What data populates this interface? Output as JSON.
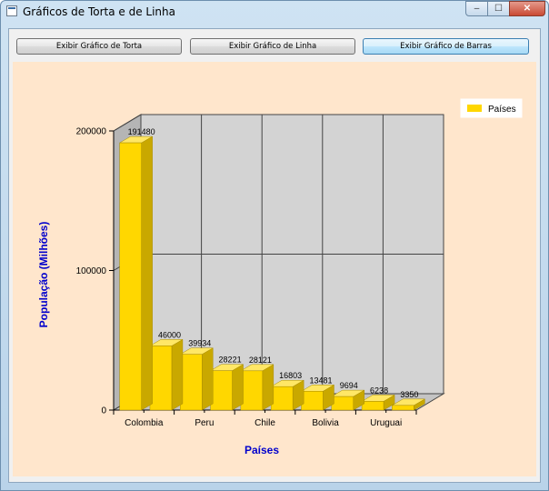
{
  "window": {
    "title": "Gráficos de Torta e de Linha",
    "buttons": {
      "minimize": "–",
      "maximize": "☐",
      "close": "✕"
    }
  },
  "toolbar": {
    "buttons": [
      {
        "label": "Exibir Gráfico de Torta",
        "active": false
      },
      {
        "label": "Exibir Gráfico de Linha",
        "active": false
      },
      {
        "label": "Exibir Gráfico de Barras",
        "active": true
      }
    ]
  },
  "colors": {
    "bar": "#ffd700",
    "bar_side": "#c9a800",
    "bar_top": "#ffe766",
    "plot_back": "#d3d3d3",
    "background": "#ffe6cc",
    "axis_title": "#0000cc"
  },
  "chart_data": {
    "type": "bar",
    "style": "3d",
    "values": [
      191480,
      46000,
      39934,
      28221,
      28121,
      16803,
      13481,
      9694,
      6238,
      3350
    ],
    "data_labels": [
      "191480",
      "46000",
      "39934",
      "28221",
      "28121",
      "16803",
      "13481",
      "9694",
      "6238",
      "3350"
    ],
    "x_tick_labels": [
      "Colombia",
      "Peru",
      "Chile",
      "Bolivia",
      "Uruguai"
    ],
    "y_ticks": [
      0,
      100000,
      200000
    ],
    "y_tick_labels": [
      "0",
      "100000",
      "200000"
    ],
    "ylim": [
      0,
      200000
    ],
    "xlabel": "Países",
    "ylabel": "População (Milhões)",
    "legend": {
      "entries": [
        "Países"
      ],
      "position": "top-right"
    },
    "grid": true
  }
}
